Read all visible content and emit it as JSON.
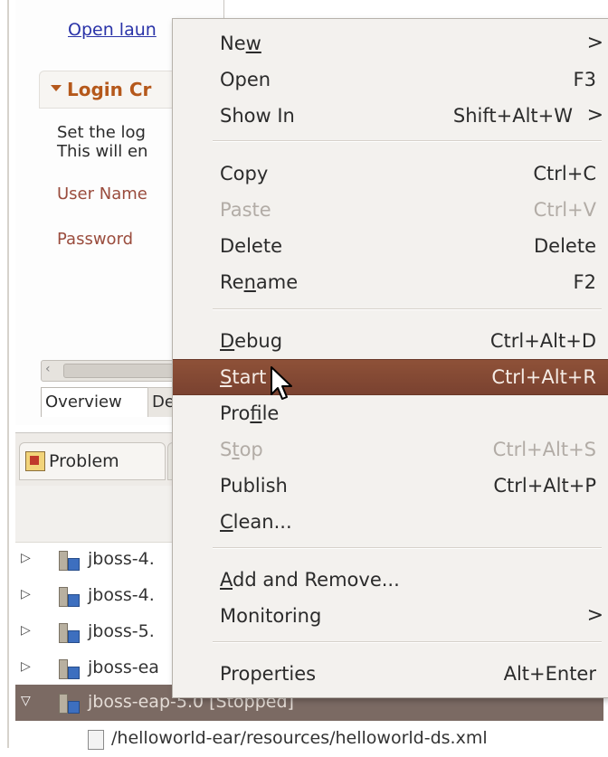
{
  "editor": {
    "open_link": "Open laun",
    "login_title": "Login Cr",
    "login_desc": "Set the log\nThis will en",
    "user_label": "User Name",
    "password_label": "Password",
    "tabs": [
      "Overview",
      "Dep"
    ]
  },
  "servers_view": {
    "tabs": [
      "Problem"
    ],
    "rows": [
      {
        "label": "jboss-4.",
        "expander": "▷"
      },
      {
        "label": "jboss-4.",
        "expander": "▷"
      },
      {
        "label": "jboss-5.",
        "expander": "▷"
      },
      {
        "label": "jboss-ea",
        "expander": "▷"
      },
      {
        "label": "jboss-eap-5.0  [Stopped]",
        "expander": "▽",
        "selected": true
      },
      {
        "label": "/helloworld-ear/resources/helloworld-ds.xml",
        "child": true
      }
    ]
  },
  "context_menu": {
    "items": [
      {
        "label": "New",
        "mnemonic": "w",
        "shortcut": "",
        "submenu": true
      },
      {
        "label": "Open",
        "shortcut": "F3"
      },
      {
        "label": "Show In",
        "shortcut": "Shift+Alt+W",
        "submenu": true
      },
      {
        "label": "Copy",
        "shortcut": "Ctrl+C"
      },
      {
        "label": "Paste",
        "shortcut": "Ctrl+V",
        "disabled": true
      },
      {
        "label": "Delete",
        "shortcut": "Delete"
      },
      {
        "label": "Rename",
        "shortcut": "F2"
      },
      {
        "label": "Debug",
        "shortcut": "Ctrl+Alt+D"
      },
      {
        "label": "Start",
        "shortcut": "Ctrl+Alt+R",
        "highlighted": true
      },
      {
        "label": "Profile",
        "shortcut": ""
      },
      {
        "label": "Stop",
        "shortcut": "Ctrl+Alt+S",
        "disabled": true
      },
      {
        "label": "Publish",
        "shortcut": "Ctrl+Alt+P"
      },
      {
        "label": "Clean...",
        "shortcut": ""
      },
      {
        "label": "Add and Remove...",
        "shortcut": ""
      },
      {
        "label": "Monitoring",
        "shortcut": "",
        "submenu": true
      },
      {
        "label": "Properties",
        "shortcut": "Alt+Enter"
      }
    ],
    "submenu_glyph": ">"
  },
  "colors": {
    "highlight": "#8e5138",
    "section_title": "#b5581b",
    "link": "#2a33a8",
    "selected_row": "#7b6a63"
  },
  "icons": [
    "server-icon",
    "problems-icon",
    "file-icon",
    "mouse-cursor-icon",
    "submenu-arrow-icon"
  ]
}
